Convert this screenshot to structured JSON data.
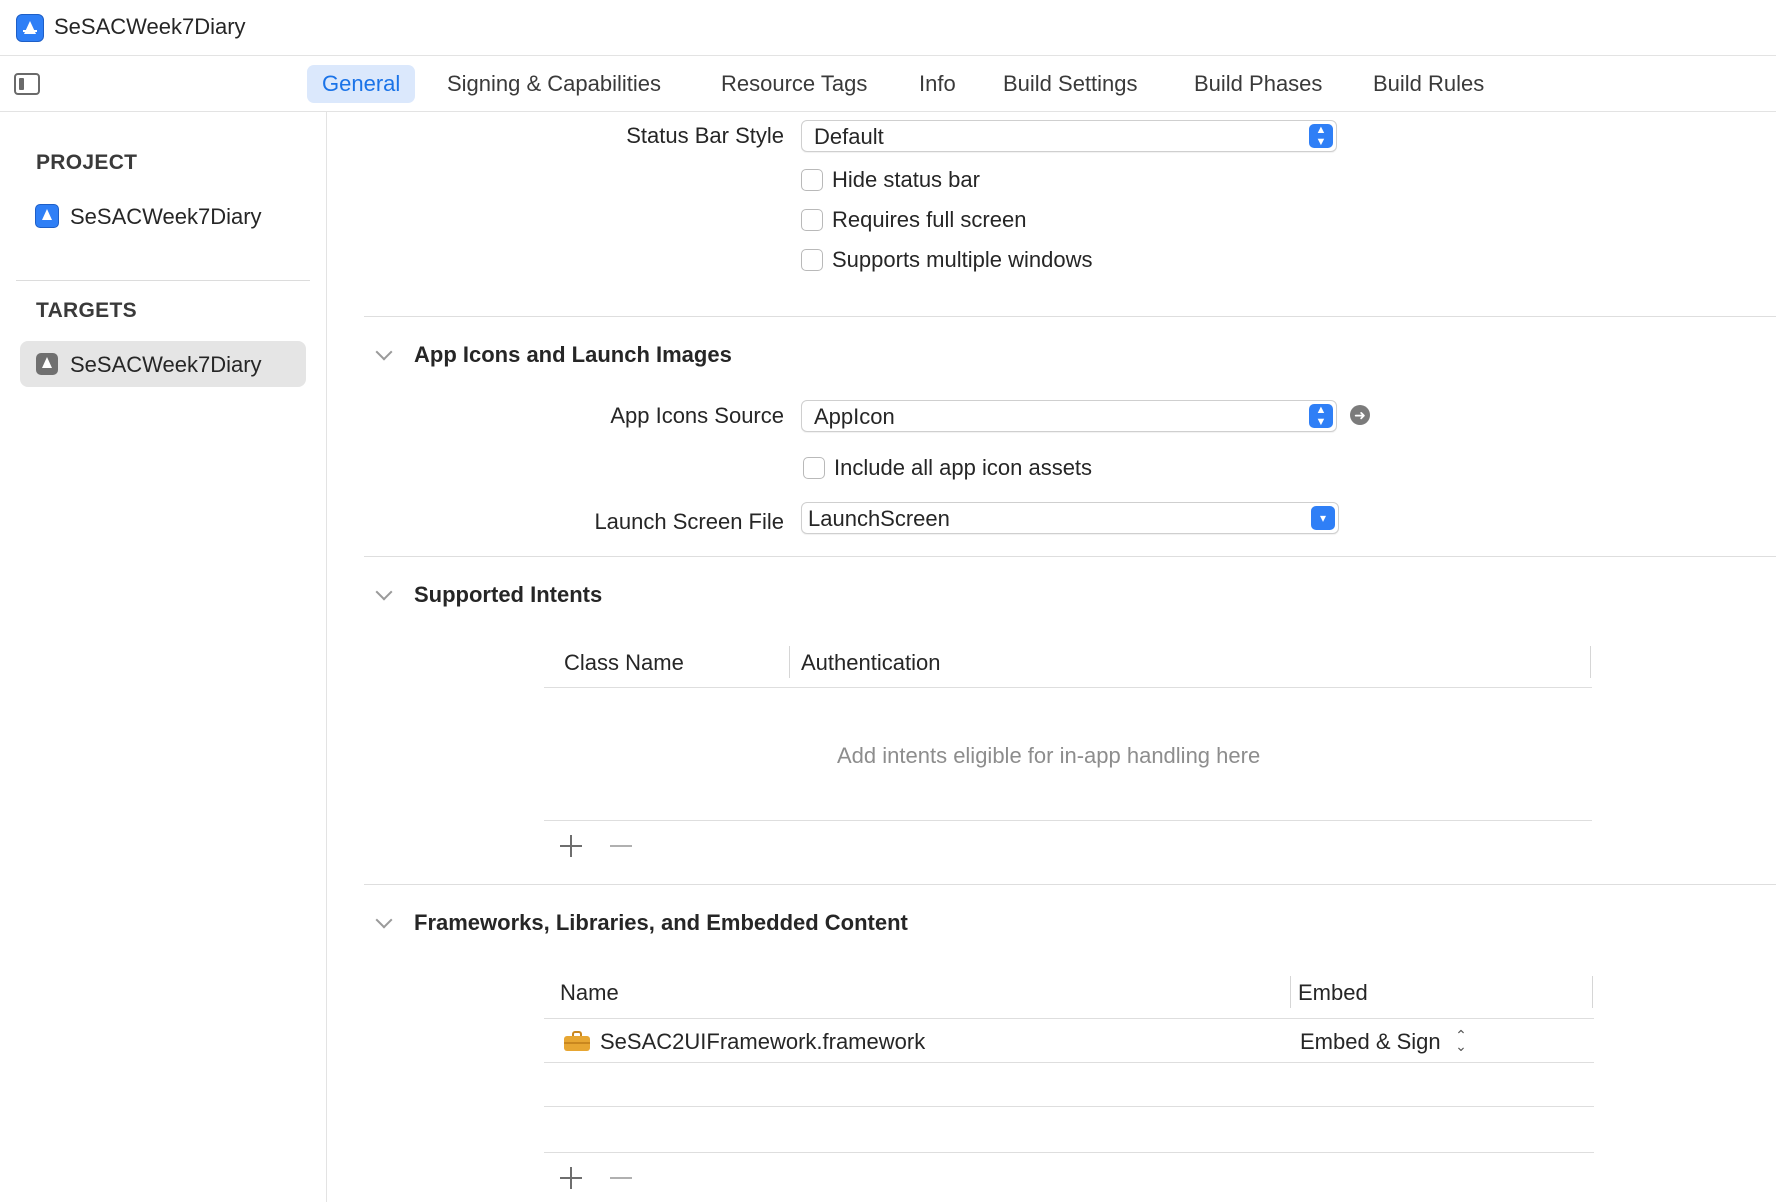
{
  "window": {
    "title": "SeSACWeek7Diary"
  },
  "tabs": [
    {
      "label": "General",
      "active": true
    },
    {
      "label": "Signing & Capabilities"
    },
    {
      "label": "Resource Tags"
    },
    {
      "label": "Info"
    },
    {
      "label": "Build Settings"
    },
    {
      "label": "Build Phases"
    },
    {
      "label": "Build Rules"
    }
  ],
  "sidebar": {
    "project_header": "PROJECT",
    "project_item": "SeSACWeek7Diary",
    "targets_header": "TARGETS",
    "target_item": "SeSACWeek7Diary"
  },
  "deployment": {
    "status_bar_style_label": "Status Bar Style",
    "status_bar_style_value": "Default",
    "hide_status_bar": {
      "label": "Hide status bar",
      "checked": false
    },
    "requires_full_screen": {
      "label": "Requires full screen",
      "checked": false
    },
    "supports_multiple_windows": {
      "label": "Supports multiple windows",
      "checked": false
    }
  },
  "app_icons": {
    "title": "App Icons and Launch Images",
    "icons_source_label": "App Icons Source",
    "icons_source_value": "AppIcon",
    "include_all": {
      "label": "Include all app icon assets",
      "checked": false
    },
    "launch_screen_label": "Launch Screen File",
    "launch_screen_value": "LaunchScreen"
  },
  "supported_intents": {
    "title": "Supported Intents",
    "columns": [
      "Class Name",
      "Authentication"
    ],
    "empty_text": "Add intents eligible for in-app handling here"
  },
  "frameworks": {
    "title": "Frameworks, Libraries, and Embedded Content",
    "columns": [
      "Name",
      "Embed"
    ],
    "rows": [
      {
        "name": "SeSAC2UIFramework.framework",
        "embed": "Embed & Sign"
      }
    ]
  },
  "colors": {
    "accent": "#2f7ff6",
    "tab_active_bg": "#dbe8fc",
    "tab_active_text": "#1a73e8"
  }
}
